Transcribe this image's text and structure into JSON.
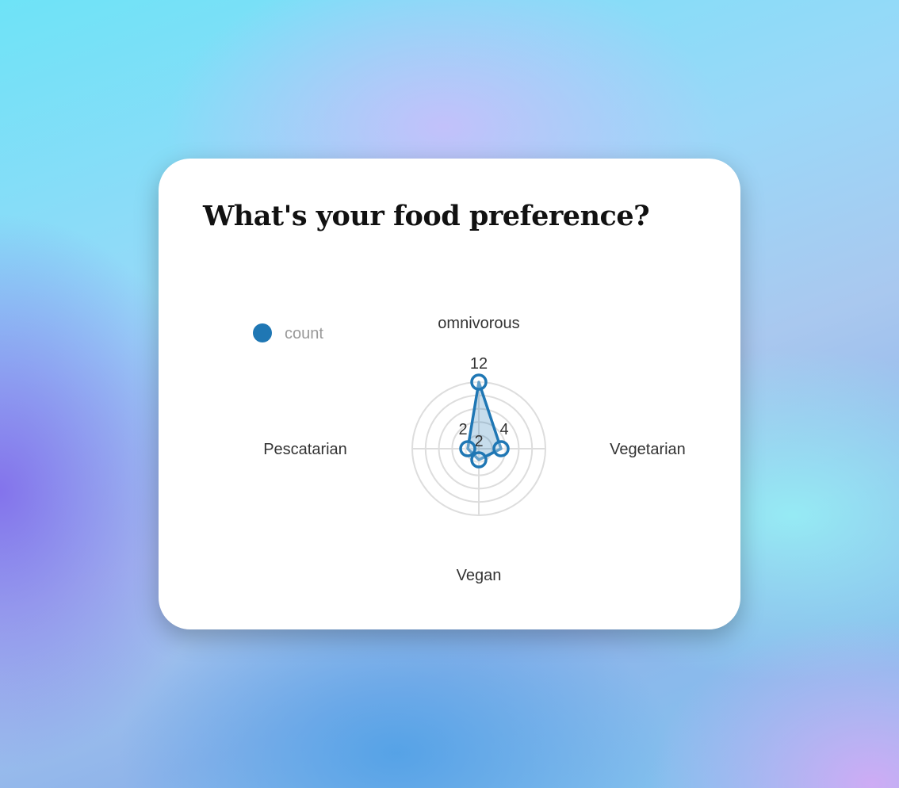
{
  "card": {
    "title": "What's your food preference?"
  },
  "chart_data": {
    "type": "radar",
    "title": "What's your food preference?",
    "categories": [
      "omnivorous",
      "Vegetarian",
      "Vegan",
      "Pescatarian"
    ],
    "series": [
      {
        "name": "count",
        "values": [
          12,
          4,
          2,
          2
        ],
        "color": "#1f77b4"
      }
    ],
    "rmax": 12,
    "rings": 5,
    "legend": "top-left"
  }
}
